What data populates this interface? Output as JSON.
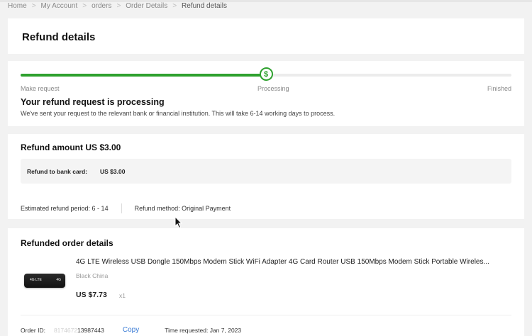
{
  "breadcrumb": [
    "Home",
    "My Account",
    "orders",
    "Order Details",
    "Refund details"
  ],
  "page_title": "Refund details",
  "progress": {
    "steps": [
      "Make request",
      "Processing",
      "Finished"
    ],
    "current_step": 2,
    "fill_fraction": 0.5,
    "status_title": "Your refund request is processing",
    "status_desc": "We've sent your request to the relevant bank or financial institution. This will take 6-14 working days to process.",
    "icon": "dollar-refresh-icon"
  },
  "refund": {
    "title": "Refund amount US $3.00",
    "bank_label": "Refund to bank card:",
    "bank_value": "US $3.00",
    "period": "Estimated refund period: 6 - 14",
    "method": "Refund method: Original Payment"
  },
  "order": {
    "title": "Refunded order details",
    "product_name": "4G LTE Wireless USB Dongle 150Mbps Modem Stick WiFi Adapter 4G Card Router USB 150Mbps Modem Stick Portable Wireles...",
    "variant": "Black China",
    "price": "US $7.73",
    "qty": "x1",
    "order_id_label": "Order ID:",
    "order_id_masked": "8174672",
    "order_id_visible": "13987443",
    "copy_label": "Copy",
    "time_requested": "Time requested: Jan 7, 2023"
  },
  "colors": {
    "accent_green": "#2ea12e",
    "link_blue": "#3a7bd5"
  }
}
